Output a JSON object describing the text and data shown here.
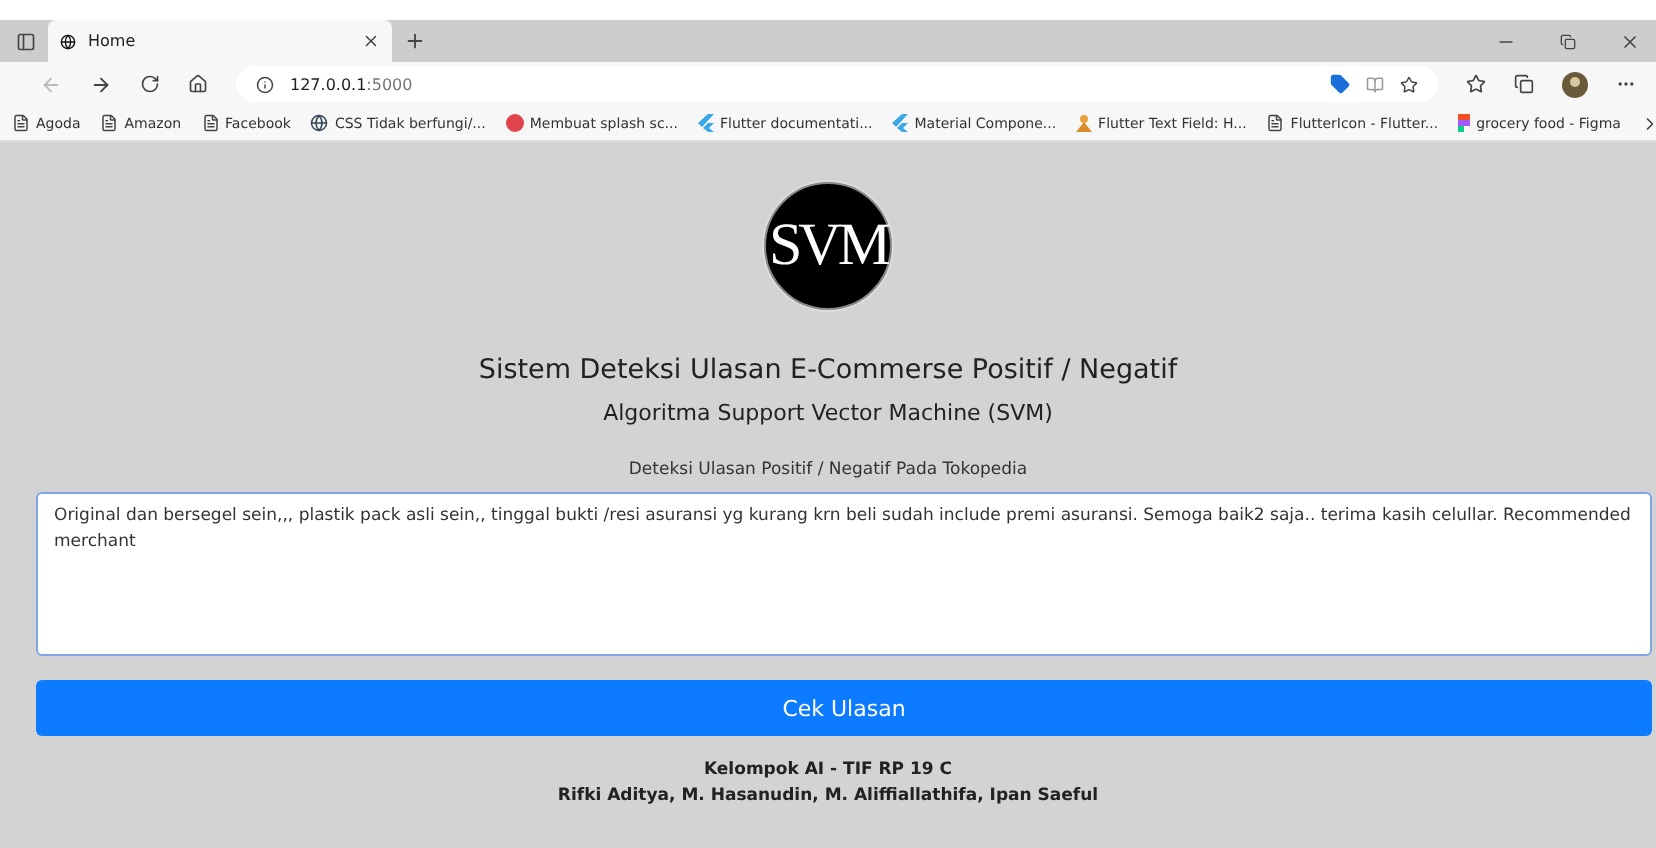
{
  "browser": {
    "tabs": [
      {
        "title": "Home",
        "selected": true
      }
    ],
    "address": {
      "host": "127.0.0.1",
      "port": ":5000"
    },
    "bookmarks": [
      {
        "label": "Agoda",
        "kind": "page"
      },
      {
        "label": "Amazon",
        "kind": "page"
      },
      {
        "label": "Facebook",
        "kind": "page"
      },
      {
        "label": "CSS Tidak berfungi/...",
        "kind": "globe"
      },
      {
        "label": "Membuat splash sc...",
        "kind": "red"
      },
      {
        "label": "Flutter documentati...",
        "kind": "flutter"
      },
      {
        "label": "Material Compone...",
        "kind": "flutter"
      },
      {
        "label": "Flutter Text Field: H...",
        "kind": "person"
      },
      {
        "label": "FlutterIcon - Flutter...",
        "kind": "page"
      },
      {
        "label": "grocery food - Figma",
        "kind": "figma"
      }
    ]
  },
  "page": {
    "logo": "SVM",
    "title": "Sistem Deteksi Ulasan E-Commerse Positif / Negatif",
    "subtitle": "Algoritma Support Vector Machine (SVM)",
    "field_label": "Deteksi Ulasan Positif / Negatif Pada Tokopedia",
    "review": "Original dan bersegel sein,,, plastik pack asli sein,, tinggal bukti /resi asuransi yg kurang krn beli sudah include premi asuransi. Semoga baik2 saja.. terima kasih celullar. Recommended merchant",
    "button": "Cek Ulasan",
    "footer": [
      "Kelompok AI - TIF RP 19 C",
      "Rifki Aditya, M. Hasanudin, M. Aliffiallathifa, Ipan Saeful"
    ]
  }
}
